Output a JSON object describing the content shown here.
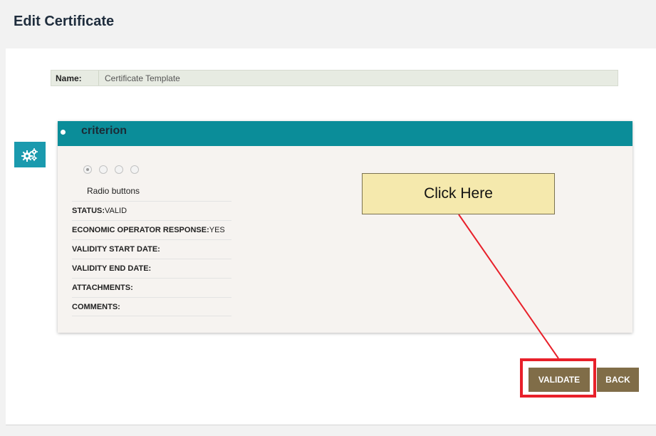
{
  "page": {
    "title": "Edit Certificate"
  },
  "name_field": {
    "label": "Name:",
    "value": "Certificate Template"
  },
  "settings_button": {
    "icon": "gears-icon",
    "color": "#1a9aae"
  },
  "card": {
    "title": "criterion",
    "header_color": "#0b8d99",
    "radio_caption": "Radio buttons",
    "radio_selected_index": 0,
    "fields": [
      {
        "label": "STATUS:",
        "value": "VALID"
      },
      {
        "label": "ECONOMIC OPERATOR RESPONSE:",
        "value": "YES"
      },
      {
        "label": "VALIDITY START DATE:",
        "value": ""
      },
      {
        "label": "VALIDITY END DATE:",
        "value": ""
      },
      {
        "label": "ATTACHMENTS:",
        "value": ""
      },
      {
        "label": "COMMENTS:",
        "value": ""
      }
    ]
  },
  "annotation": {
    "callout_text": "Click Here",
    "highlight_color": "#e8202a"
  },
  "actions": {
    "validate_label": "VALIDATE",
    "back_label": "BACK",
    "button_color": "#806d48"
  }
}
